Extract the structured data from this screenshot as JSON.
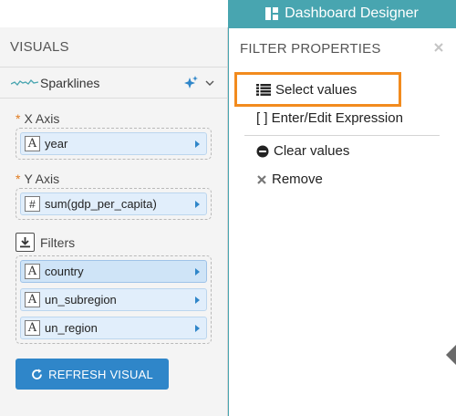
{
  "topbar": {
    "designer_tab_label": "Dashboard Designer",
    "designer_tab_icon": "dashboard-icon"
  },
  "left_panel": {
    "title": "VISUALS",
    "visual_type": {
      "icon": "sparkline-icon",
      "label": "Sparklines",
      "action_icon": "sparkle-icon",
      "dropdown_icon": "chevron-down-icon"
    },
    "x_axis": {
      "required_marker": "*",
      "label": "X Axis",
      "fields": [
        {
          "type_icon": "A",
          "name": "year"
        }
      ]
    },
    "y_axis": {
      "required_marker": "*",
      "label": "Y Axis",
      "fields": [
        {
          "type_icon": "#",
          "name": "sum(gdp_per_capita)"
        }
      ]
    },
    "filters": {
      "label": "Filters",
      "icon": "download-icon",
      "fields": [
        {
          "type_icon": "A",
          "name": "country",
          "selected": true
        },
        {
          "type_icon": "A",
          "name": "un_subregion",
          "selected": false
        },
        {
          "type_icon": "A",
          "name": "un_region",
          "selected": false
        }
      ]
    },
    "refresh_button": {
      "icon": "refresh-icon",
      "label": "REFRESH VISUAL"
    }
  },
  "right_panel": {
    "title": "FILTER PROPERTIES",
    "close_icon": "close-icon",
    "menu": [
      {
        "icon": "list-icon",
        "label": "Select values",
        "highlighted": true
      },
      {
        "icon": "brackets",
        "label": "[ ] Enter/Edit Expression"
      },
      {
        "icon": "minus-circle-icon",
        "label": "Clear values"
      },
      {
        "icon": "close-icon",
        "label": "Remove"
      }
    ]
  },
  "colors": {
    "accent_teal": "#48a5b0",
    "primary_blue": "#2f86c9",
    "highlight_orange": "#f28b1e",
    "pill_bg": "#e1eefb",
    "required_orange": "#e07b20"
  }
}
